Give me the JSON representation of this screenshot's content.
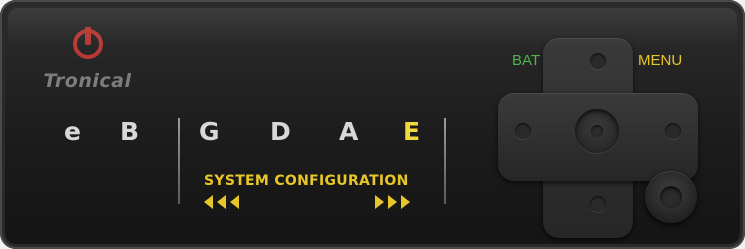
{
  "brand": {
    "name": "Tronical"
  },
  "strings": [
    {
      "label": "e",
      "active": false
    },
    {
      "label": "B",
      "active": false
    },
    {
      "label": "G",
      "active": false
    },
    {
      "label": "D",
      "active": false
    },
    {
      "label": "A",
      "active": false
    },
    {
      "label": "E",
      "active": true
    }
  ],
  "config": {
    "label": "SYSTEM CONFIGURATION"
  },
  "buttons": {
    "bat_label": "BAT",
    "menu_label": "MENU"
  },
  "colors": {
    "accent": "#e8c629",
    "bat": "#4fb34a",
    "logo": "#b83a36",
    "text": "#d8d8d8"
  }
}
